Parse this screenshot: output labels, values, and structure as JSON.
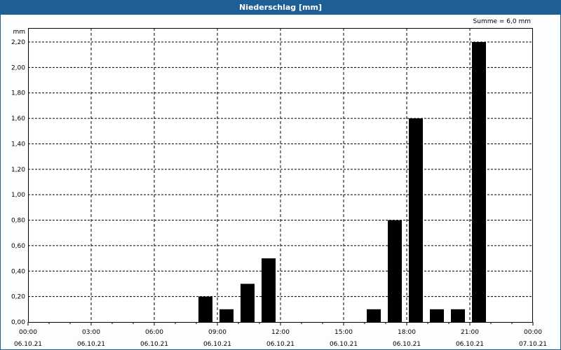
{
  "window": {
    "title": "Niederschlag [mm]"
  },
  "chart_data": {
    "type": "bar",
    "title": "Niederschlag [mm]",
    "annotation": "Summe = 6,0 mm",
    "ylabel": "mm",
    "xlabel": "",
    "ylim": [
      0,
      2.2
    ],
    "xlim_hours": [
      0,
      24
    ],
    "grid": true,
    "y_ticks": [
      "0,00",
      "0,20",
      "0,40",
      "0,60",
      "0,80",
      "1,00",
      "1,20",
      "1,40",
      "1,60",
      "1,80",
      "2,00",
      "2,20"
    ],
    "x_ticks": [
      {
        "time": "00:00",
        "date": "06.10.21"
      },
      {
        "time": "03:00",
        "date": "06.10.21"
      },
      {
        "time": "06:00",
        "date": "06.10.21"
      },
      {
        "time": "09:00",
        "date": "06.10.21"
      },
      {
        "time": "12:00",
        "date": "06.10.21"
      },
      {
        "time": "15:00",
        "date": "06.10.21"
      },
      {
        "time": "18:00",
        "date": "06.10.21"
      },
      {
        "time": "21:00",
        "date": "06.10.21"
      },
      {
        "time": "00:00",
        "date": "07.10.21"
      }
    ],
    "bars": [
      {
        "hour": 8,
        "value": 0.2
      },
      {
        "hour": 9,
        "value": 0.1
      },
      {
        "hour": 10,
        "value": 0.3
      },
      {
        "hour": 11,
        "value": 0.5
      },
      {
        "hour": 16,
        "value": 0.1
      },
      {
        "hour": 17,
        "value": 0.8
      },
      {
        "hour": 18,
        "value": 1.6
      },
      {
        "hour": 19,
        "value": 0.1
      },
      {
        "hour": 20,
        "value": 0.1
      },
      {
        "hour": 21,
        "value": 2.2
      }
    ],
    "bar_color": "#000000"
  }
}
